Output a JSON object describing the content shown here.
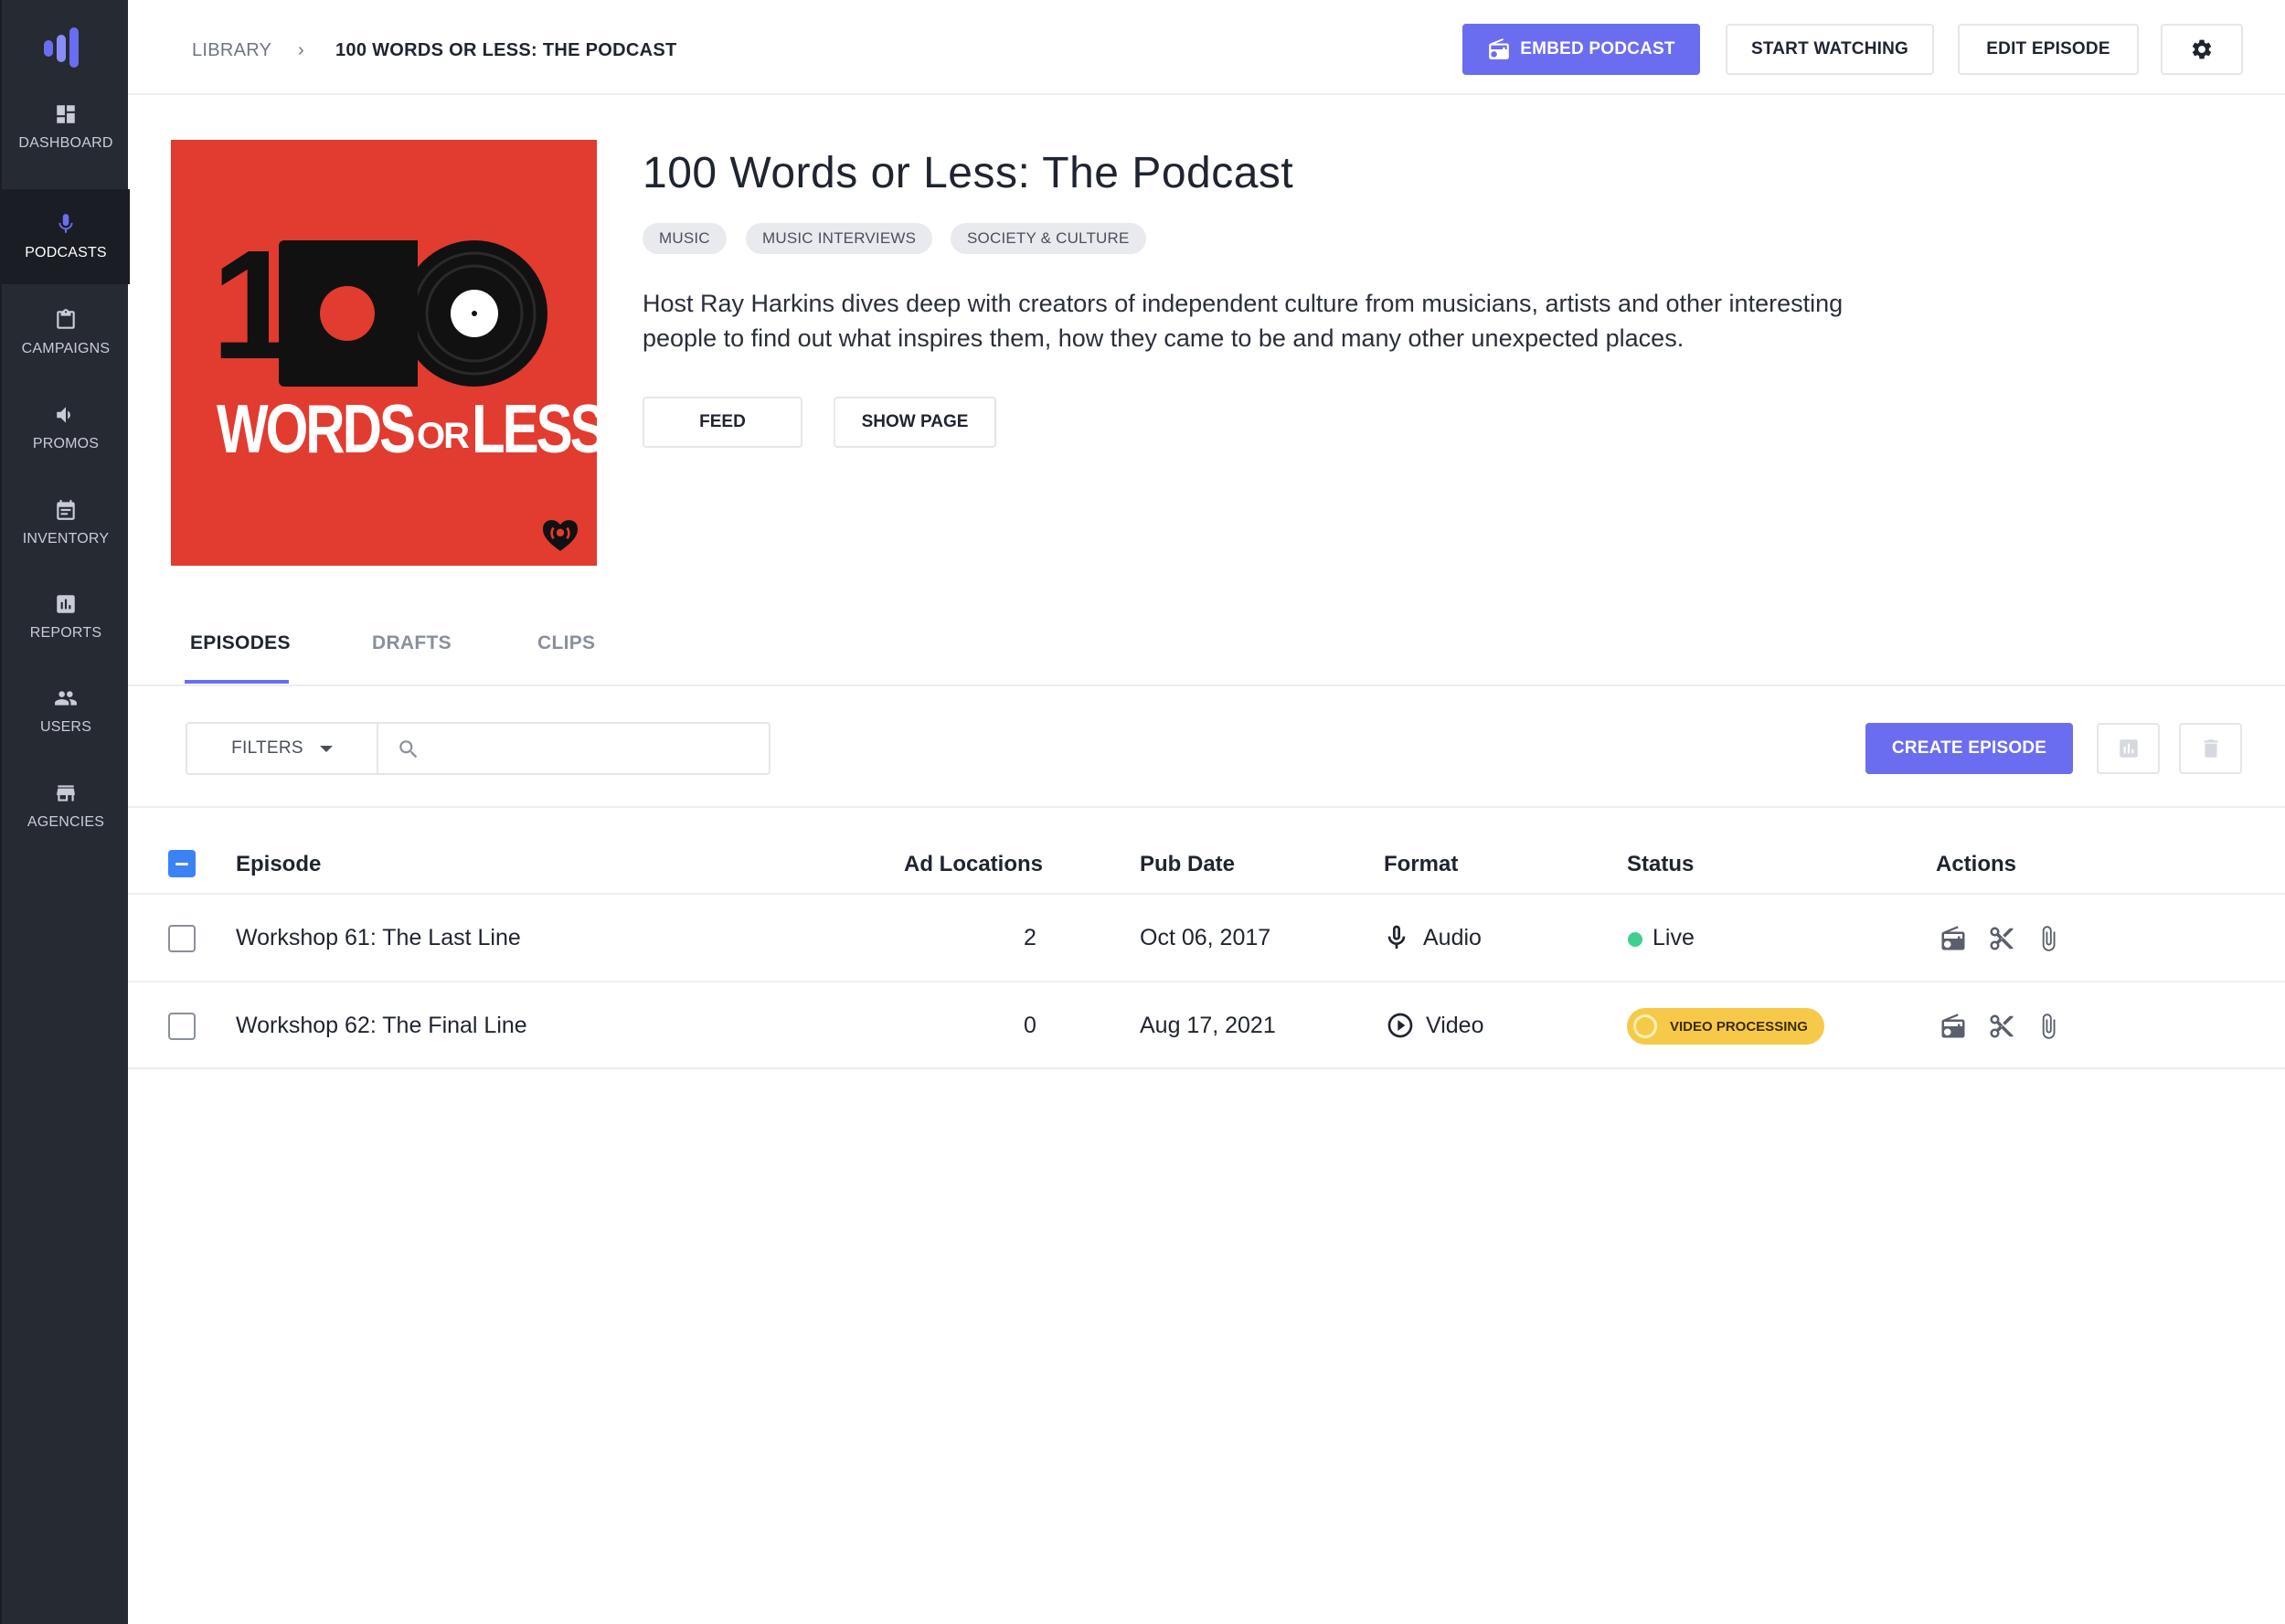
{
  "nav": {
    "items": [
      {
        "label": "DASHBOARD",
        "icon": "dashboard-icon"
      },
      {
        "label": "PODCASTS",
        "icon": "microphone-icon"
      },
      {
        "label": "CAMPAIGNS",
        "icon": "clipboard-icon"
      },
      {
        "label": "PROMOS",
        "icon": "megaphone-icon"
      },
      {
        "label": "INVENTORY",
        "icon": "calendar-icon"
      },
      {
        "label": "REPORTS",
        "icon": "bar-chart-icon"
      },
      {
        "label": "USERS",
        "icon": "users-icon"
      },
      {
        "label": "AGENCIES",
        "icon": "storefront-icon"
      }
    ],
    "active": "PODCASTS"
  },
  "breadcrumb": {
    "library": "LIBRARY",
    "separator": "›",
    "current": "100 WORDS OR LESS: THE PODCAST"
  },
  "header": {
    "embed_label": "EMBED PODCAST",
    "watch_label": "START WATCHING",
    "edit_label": "EDIT EPISODE"
  },
  "podcast": {
    "cover_top": "1",
    "cover_bottom_left": "WORDS",
    "cover_bottom_mid": "OR",
    "cover_bottom_right": "LESS",
    "title": "100 Words or Less: The Podcast",
    "tags": [
      "MUSIC",
      "MUSIC INTERVIEWS",
      "SOCIETY & CULTURE"
    ],
    "description": "Host Ray Harkins dives deep with creators of independent culture from musicians, artists and other interesting people to find out what inspires them, how they came to be and many other unexpected places.",
    "feed_label": "FEED",
    "show_page_label": "SHOW PAGE"
  },
  "tabs": [
    "EPISODES",
    "DRAFTS",
    "CLIPS"
  ],
  "toolbar": {
    "filters_label": "FILTERS",
    "search_placeholder": "",
    "create_label": "CREATE EPISODE"
  },
  "table": {
    "columns": [
      "Episode",
      "Ad Locations",
      "Pub Date",
      "Format",
      "Status",
      "Actions"
    ],
    "rows": [
      {
        "episode": "Workshop 61: The Last Line",
        "ad_locations": "2",
        "pub_date": "Oct 06, 2017",
        "format": "Audio",
        "status": "Live"
      },
      {
        "episode": "Workshop 62: The Final Line",
        "ad_locations": "0",
        "pub_date": "Aug 17, 2021",
        "format": "Video",
        "status": "VIDEO PROCESSING"
      }
    ]
  },
  "colors": {
    "accent": "#6b6df0",
    "sidebar": "#262a33",
    "live": "#3fcf8e",
    "processing": "#f7c948",
    "cover": "#e23b30"
  }
}
